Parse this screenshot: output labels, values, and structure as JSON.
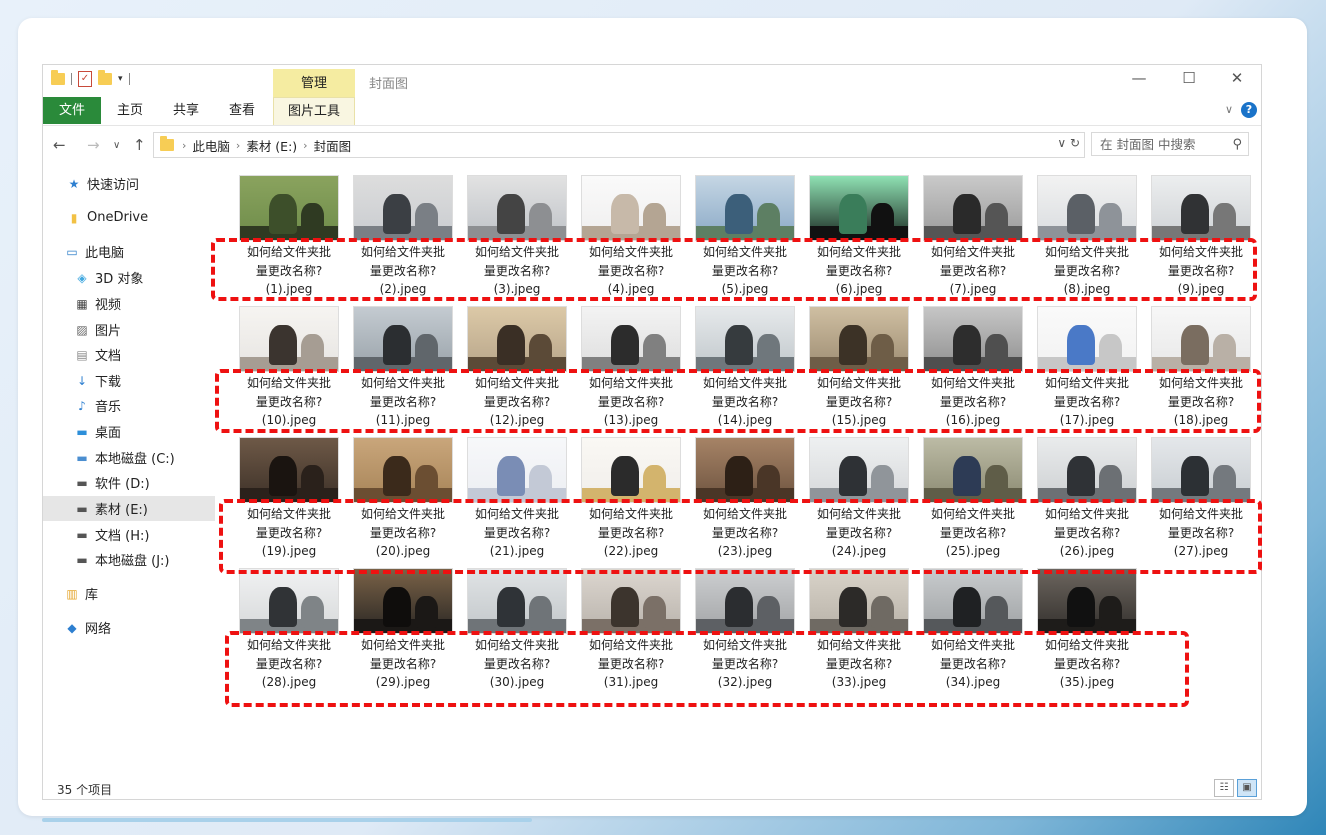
{
  "window": {
    "title": "封面图",
    "manage_tab": "管理",
    "minimize": "—",
    "maximize": "☐",
    "close": "✕"
  },
  "ribbon": {
    "tabs": [
      "文件",
      "主页",
      "共享",
      "查看",
      "图片工具"
    ],
    "collapse_chevron": "∨",
    "help": "?"
  },
  "address": {
    "back": "←",
    "forward": "→",
    "recent": "∨",
    "up": "↑",
    "crumbs": [
      "此电脑",
      "素材 (E:)",
      "封面图"
    ],
    "dropdown": "∨",
    "refresh": "↻",
    "search_placeholder": "在 封面图 中搜索"
  },
  "sidebar": {
    "items": [
      {
        "label": "快速访问",
        "icon": "star-icon"
      },
      {
        "label": "OneDrive",
        "icon": "onedrive-folder-icon"
      },
      {
        "label": "此电脑",
        "icon": "computer-icon"
      },
      {
        "label": "3D 对象",
        "icon": "3d-objects-icon"
      },
      {
        "label": "视频",
        "icon": "video-icon"
      },
      {
        "label": "图片",
        "icon": "pictures-icon"
      },
      {
        "label": "文档",
        "icon": "documents-icon"
      },
      {
        "label": "下载",
        "icon": "download-icon"
      },
      {
        "label": "音乐",
        "icon": "music-icon"
      },
      {
        "label": "桌面",
        "icon": "desktop-icon"
      },
      {
        "label": "本地磁盘 (C:)",
        "icon": "system-drive-icon"
      },
      {
        "label": "软件 (D:)",
        "icon": "drive-icon"
      },
      {
        "label": "素材 (E:)",
        "icon": "drive-icon",
        "selected": true
      },
      {
        "label": "文档 (H:)",
        "icon": "drive-icon"
      },
      {
        "label": "本地磁盘 (J:)",
        "icon": "drive-icon"
      },
      {
        "label": "库",
        "icon": "library-icon"
      },
      {
        "label": "网络",
        "icon": "network-icon"
      }
    ]
  },
  "files": {
    "caption_line1": "如何给文件夹批",
    "caption_line2": "量更改名称?",
    "names": [
      "(1).jpeg",
      "(2).jpeg",
      "(3).jpeg",
      "(4).jpeg",
      "(5).jpeg",
      "(6).jpeg",
      "(7).jpeg",
      "(8).jpeg",
      "(9).jpeg",
      "(10).jpeg",
      "(11).jpeg",
      "(12).jpeg",
      "(13).jpeg",
      "(14).jpeg",
      "(15).jpeg",
      "(16).jpeg",
      "(17).jpeg",
      "(18).jpeg",
      "(19).jpeg",
      "(20).jpeg",
      "(21).jpeg",
      "(22).jpeg",
      "(23).jpeg",
      "(24).jpeg",
      "(25).jpeg",
      "(26).jpeg",
      "(27).jpeg",
      "(28).jpeg",
      "(29).jpeg",
      "(30).jpeg",
      "(31).jpeg",
      "(32).jpeg",
      "(33).jpeg",
      "(34).jpeg",
      "(35).jpeg"
    ]
  },
  "status": {
    "item_count": "35 个项目"
  },
  "colors": {
    "file_tab": "#2a8a3a",
    "manage_tab": "#f5eca1",
    "highlight": "#ee1111"
  }
}
